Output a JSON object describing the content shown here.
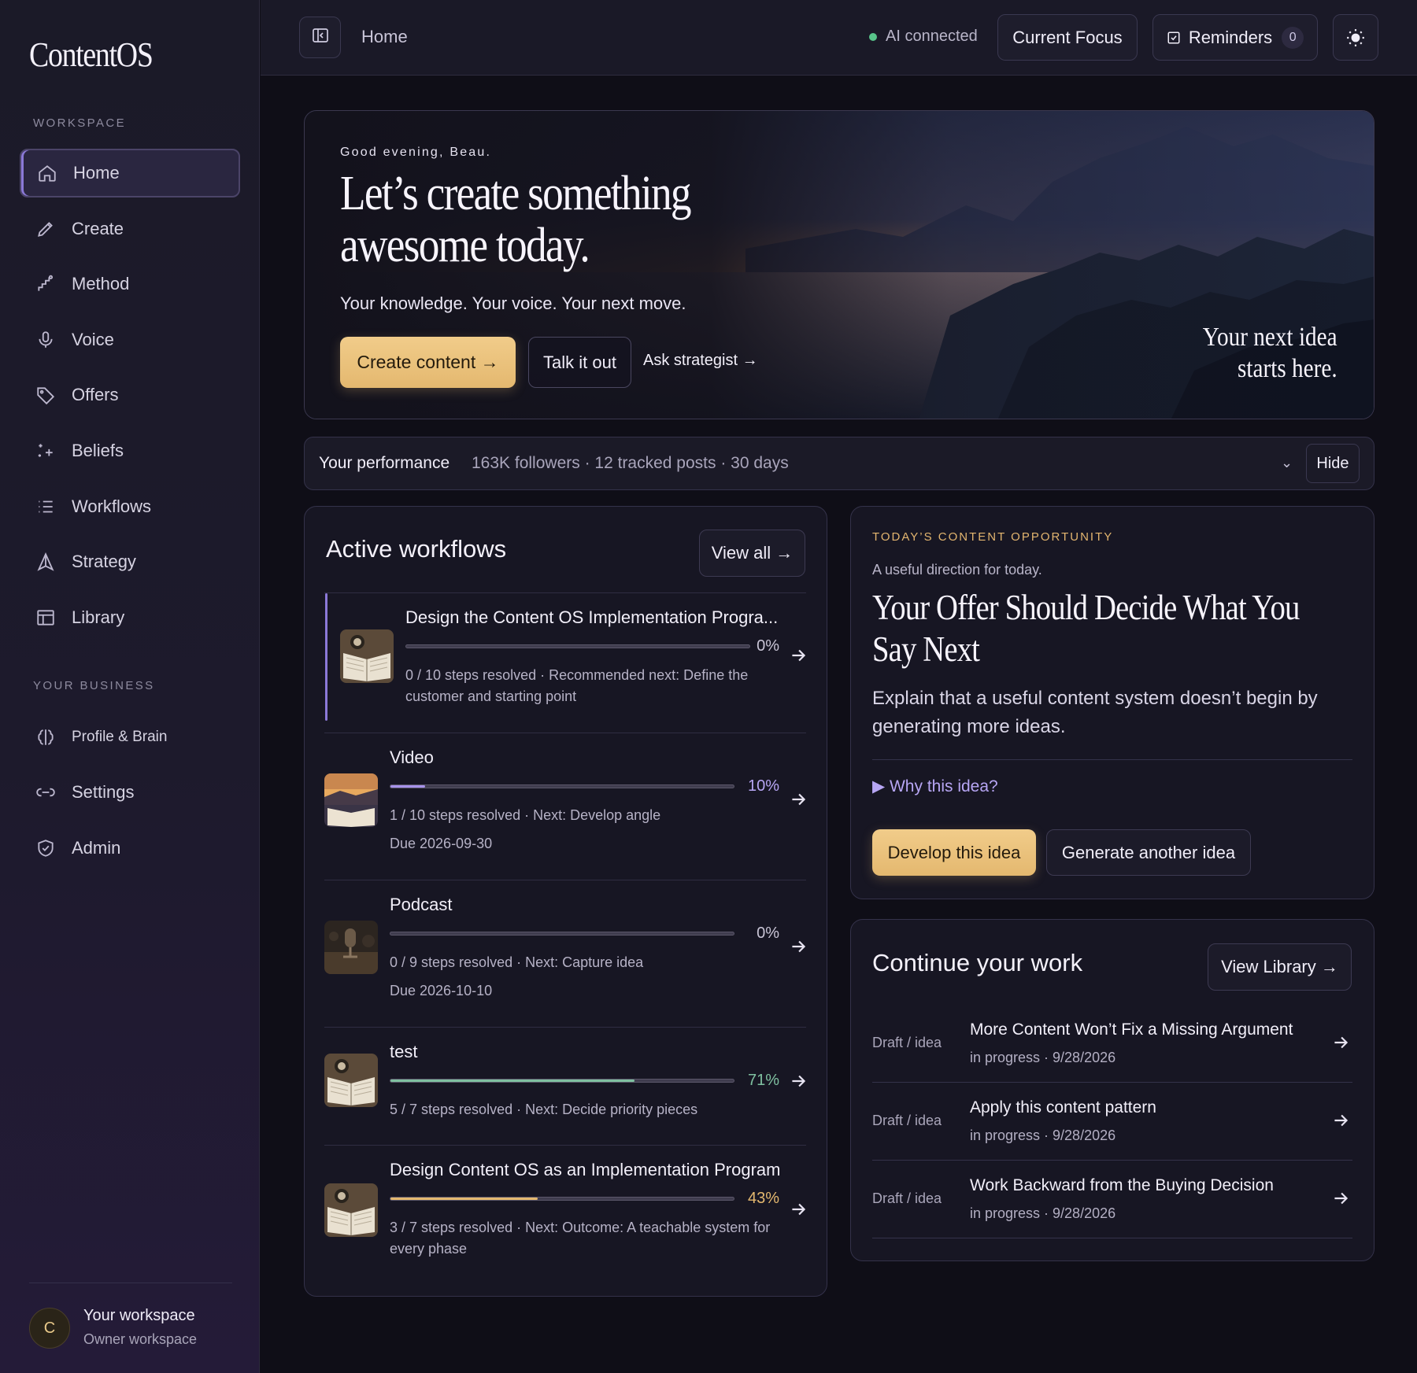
{
  "app": {
    "logo": "ContentOS"
  },
  "sidebar": {
    "workspace_label": "WORKSPACE",
    "business_label": "YOUR BUSINESS",
    "workspace_items": [
      {
        "label": "Home",
        "icon": "home-icon",
        "active": true
      },
      {
        "label": "Create",
        "icon": "pencil-icon"
      },
      {
        "label": "Method",
        "icon": "steps-icon"
      },
      {
        "label": "Voice",
        "icon": "microphone-icon"
      },
      {
        "label": "Offers",
        "icon": "tag-icon"
      },
      {
        "label": "Beliefs",
        "icon": "sparkle-icon"
      },
      {
        "label": "Workflows",
        "icon": "list-icon"
      },
      {
        "label": "Strategy",
        "icon": "compass-icon"
      },
      {
        "label": "Library",
        "icon": "layout-icon"
      }
    ],
    "business_items": [
      {
        "label": "Profile & Brain",
        "icon": "brain-icon"
      },
      {
        "label": "Settings",
        "icon": "toggle-icon"
      },
      {
        "label": "Admin",
        "icon": "shield-icon"
      }
    ],
    "workspace": {
      "avatar_initial": "C",
      "name": "Your workspace",
      "role": "Owner workspace"
    }
  },
  "topbar": {
    "breadcrumb": "Home",
    "status": "AI connected",
    "current_focus": "Current Focus",
    "reminders_label": "Reminders",
    "reminders_count": "0",
    "theme_icon": "sun-icon"
  },
  "hero": {
    "greeting": "Good evening, Beau.",
    "title": "Let’s create something awesome today.",
    "subtitle": "Your knowledge. Your voice. Your next move.",
    "primary_cta": "Create content →",
    "secondary_cta": "Talk it out",
    "link_cta": "Ask strategist →",
    "tagline_line1": "Your next idea",
    "tagline_line2": "starts here."
  },
  "performance": {
    "label": "Your performance",
    "stats": "163K followers · 12 tracked posts · 30 days",
    "hide": "Hide"
  },
  "workflows": {
    "title": "Active workflows",
    "view_all": "View all →",
    "items": [
      {
        "title": "Design the Content OS Implementation Progra...",
        "progress": 0,
        "pct": "0%",
        "meta": "0 / 10 steps resolved · Recommended next: Define the customer and starting point",
        "due": "",
        "thumb": "book"
      },
      {
        "title": "Video",
        "progress": 0.1,
        "pct": "10%",
        "meta": "1 / 10 steps resolved · Next: Develop angle",
        "due": "Due 2026-09-30",
        "thumb": "sunset"
      },
      {
        "title": "Podcast",
        "progress": 0,
        "pct": "0%",
        "meta": "0 / 9 steps resolved · Next: Capture idea",
        "due": "Due 2026-10-10",
        "thumb": "studio"
      },
      {
        "title": "test",
        "progress": 0.71,
        "pct": "71%",
        "meta": "5 / 7 steps resolved · Next: Decide priority pieces",
        "due": "",
        "thumb": "book"
      },
      {
        "title": "Design Content OS as an Implementation Program",
        "progress": 0.43,
        "pct": "43%",
        "meta": "3 / 7 steps resolved · Next: Outcome: A teachable system for every phase",
        "due": "",
        "thumb": "book"
      }
    ]
  },
  "opportunity": {
    "kicker": "TODAY’S CONTENT OPPORTUNITY",
    "note": "A useful direction for today.",
    "title": "Your Offer Should Decide What You Say Next",
    "body": "Explain that a useful content system doesn’t begin by generating more ideas.",
    "why": "▶ Why this idea?",
    "develop": "Develop this idea",
    "generate": "Generate another idea"
  },
  "continue": {
    "title": "Continue your work",
    "view_library": "View Library →",
    "items": [
      {
        "kind": "Draft / idea",
        "title": "More Content Won’t Fix a Missing Argument",
        "meta": "in progress · 9/28/2026"
      },
      {
        "kind": "Draft / idea",
        "title": "Apply this content pattern",
        "meta": "in progress · 9/28/2026"
      },
      {
        "kind": "Draft / idea",
        "title": "Work Backward from the Buying Decision",
        "meta": "in progress · 9/28/2026"
      }
    ]
  },
  "colors": {
    "accent_gold": "#e4b86f",
    "accent_purple": "#8b79d8",
    "progress_purple": "#a792ea",
    "progress_green": "#7fc0a0",
    "progress_gold": "#e4b86f",
    "status_green": "#58c48a"
  }
}
